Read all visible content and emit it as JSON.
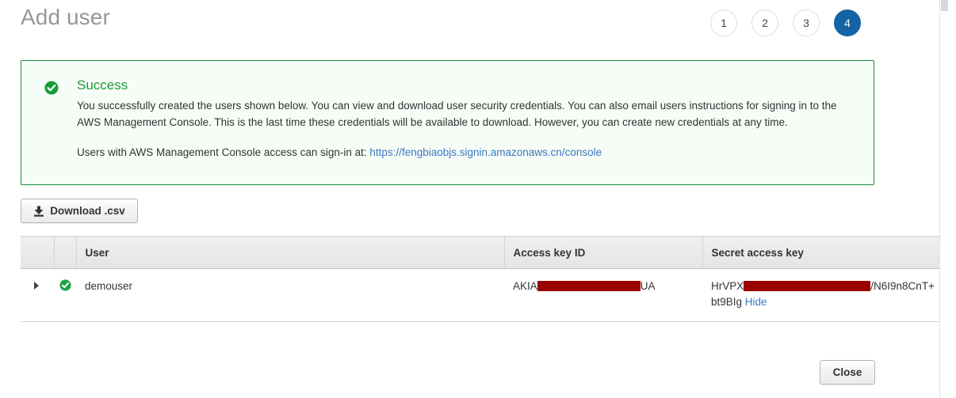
{
  "header": {
    "title": "Add user",
    "steps": [
      {
        "label": "1",
        "active": false
      },
      {
        "label": "2",
        "active": false
      },
      {
        "label": "3",
        "active": false
      },
      {
        "label": "4",
        "active": true
      }
    ]
  },
  "alert": {
    "status": "success",
    "icon": "check-circle-icon",
    "title": "Success",
    "paragraph1": "You successfully created the users shown below. You can view and download user security credentials. You can also email users instructions for signing in to the AWS Management Console. This is the last time these credentials will be available to download. However, you can create new credentials at any time.",
    "paragraph2_prefix": "Users with AWS Management Console access can sign-in at: ",
    "link_text": "https://fengbiaobjs.signin.amazonaws.cn/console",
    "border_color": "#128a3c",
    "background_color": "#f6fcf6",
    "title_color": "#1a9c3e",
    "link_color": "#3b78c3"
  },
  "toolbar": {
    "download_label": "Download .csv",
    "download_icon": "download-icon"
  },
  "table": {
    "columns": [
      "",
      "",
      "User",
      "Access key ID",
      "Secret access key"
    ],
    "rows": [
      {
        "expand_icon": "triangle-right-icon",
        "status_icon": "check-circle-icon",
        "user": "demouser",
        "access_key_id_prefix": "AKIA",
        "access_key_id_suffix": "UA",
        "secret_key_prefix": "HrVPX",
        "secret_key_suffix": "/N6I9n8Cn",
        "secret_key_line2": "T+bt9BIg",
        "hide_label": "Hide",
        "redaction_color": "#990000"
      }
    ]
  },
  "footer": {
    "close_label": "Close"
  },
  "theme": {
    "accent": "#1463a5",
    "success": "#1a9c3e",
    "link": "#3b78c3",
    "title_gray": "#969696"
  }
}
